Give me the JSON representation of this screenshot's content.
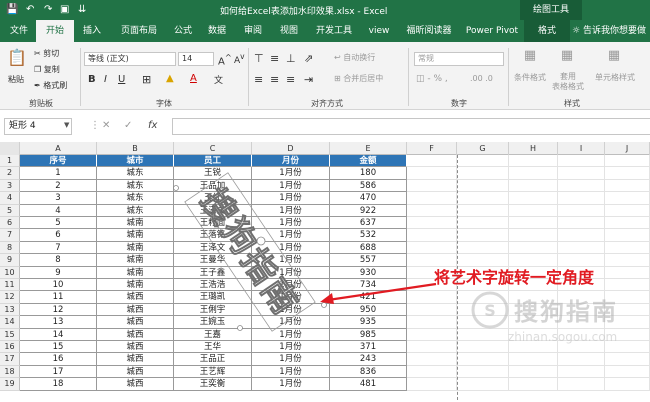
{
  "titlebar": {
    "title": "如何给Excel表添加水印效果.xlsx  -  Excel",
    "context_tab_group": "绘图工具"
  },
  "tabs": [
    "文件",
    "开始",
    "插入",
    "页面布局",
    "公式",
    "数据",
    "审阅",
    "视图",
    "开发工具",
    "view",
    "福昕阅读器",
    "Power Pivot",
    "格式"
  ],
  "tell_me": "告诉我你想要做什",
  "ribbon": {
    "clipboard": {
      "paste": "粘贴",
      "cut": "剪切",
      "copy": "复制",
      "format_painter": "格式刷",
      "label": "剪贴板"
    },
    "font": {
      "name": "等线 (正文)",
      "size": "14",
      "bold": "B",
      "italic": "I",
      "underline": "U",
      "label": "字体"
    },
    "alignment": {
      "wrap": "自动换行",
      "merge": "合并后居中",
      "label": "对齐方式"
    },
    "number": {
      "format": "常规",
      "label": "数字"
    },
    "styles": {
      "conditional": "条件格式",
      "table_format": "套用\n表格格式",
      "cell_styles": "单元格样式",
      "label": "样式"
    }
  },
  "formula_bar": {
    "name_box": "矩形 4",
    "fx": "fx",
    "value": ""
  },
  "columns": [
    "A",
    "B",
    "C",
    "D",
    "E",
    "F",
    "G",
    "H",
    "I",
    "J"
  ],
  "rows": [
    "1",
    "2",
    "3",
    "4",
    "5",
    "6",
    "7",
    "8",
    "9",
    "10",
    "11",
    "12",
    "13",
    "14",
    "15",
    "16",
    "17",
    "18",
    "19"
  ],
  "table": {
    "headers": [
      "序号",
      "城市",
      "员工",
      "月份",
      "金额"
    ],
    "rows": [
      [
        "1",
        "城东",
        "王锐",
        "1月份",
        "180"
      ],
      [
        "2",
        "城东",
        "王品加",
        "1月份",
        "586"
      ],
      [
        "3",
        "城东",
        "王红",
        "1月份",
        "470"
      ],
      [
        "4",
        "城东",
        "王泽文",
        "1月份",
        "922"
      ],
      [
        "5",
        "城南",
        "王籽面",
        "1月份",
        "637"
      ],
      [
        "6",
        "城南",
        "王落铭",
        "1月份",
        "532"
      ],
      [
        "7",
        "城南",
        "王泽文",
        "1月份",
        "688"
      ],
      [
        "8",
        "城南",
        "王曼华",
        "1月份",
        "557"
      ],
      [
        "9",
        "城南",
        "王子鑫",
        "1月份",
        "930"
      ],
      [
        "10",
        "城南",
        "王浩浩",
        "1月份",
        "734"
      ],
      [
        "11",
        "城西",
        "王璐凯",
        "1月份",
        "421"
      ],
      [
        "12",
        "城西",
        "王俐宇",
        "1月份",
        "950"
      ],
      [
        "13",
        "城西",
        "王婉玉",
        "1月份",
        "935"
      ],
      [
        "14",
        "城西",
        "王嘉",
        "1月份",
        "985"
      ],
      [
        "15",
        "城西",
        "王华",
        "1月份",
        "371"
      ],
      [
        "16",
        "城西",
        "王品正",
        "1月份",
        "243"
      ],
      [
        "17",
        "城西",
        "王艺辉",
        "1月份",
        "836"
      ],
      [
        "18",
        "城西",
        "王奕衡",
        "1月份",
        "481"
      ]
    ]
  },
  "wordart_text": "搜狗指南",
  "annotation": "将艺术字旋转一定角度",
  "watermark": {
    "cn": "搜狗指南",
    "en": "zhinan.sogou.com"
  },
  "colors": {
    "excel_green": "#217346",
    "header_fill": "#2e75b6",
    "annotation_red": "#e11b22"
  }
}
